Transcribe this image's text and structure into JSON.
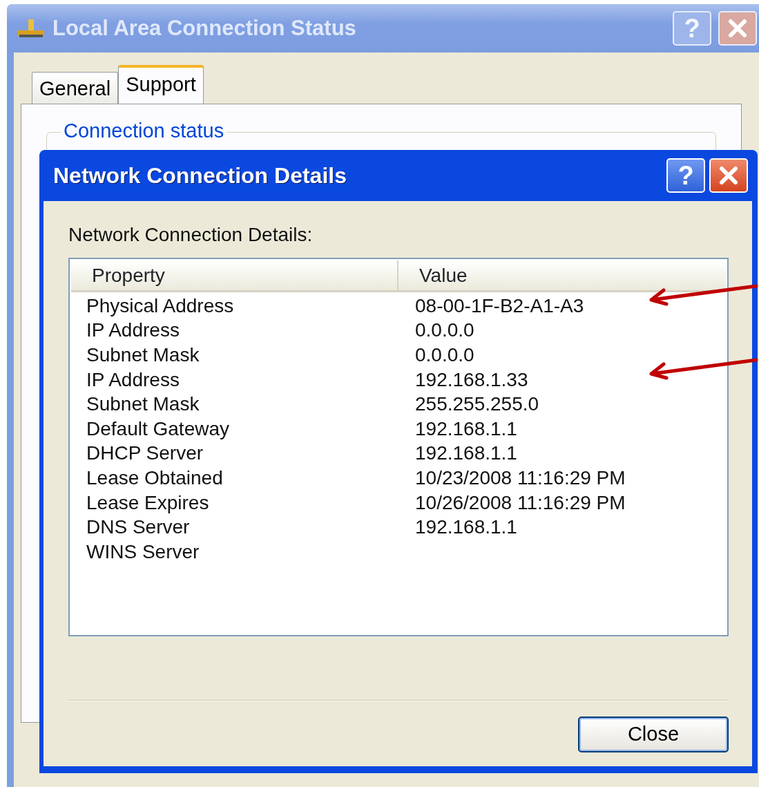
{
  "outer_window": {
    "title": "Local Area Connection Status",
    "help_button": "?",
    "tabs": [
      {
        "label": "General",
        "selected": false
      },
      {
        "label": "Support",
        "selected": true
      }
    ],
    "group_label": "Connection status"
  },
  "dialog": {
    "title": "Network Connection Details",
    "help_button": "?",
    "label": "Network Connection Details:",
    "columns": [
      "Property",
      "Value"
    ],
    "rows": [
      {
        "property": "Physical Address",
        "value": "08-00-1F-B2-A1-A3",
        "marked": true
      },
      {
        "property": "IP Address",
        "value": "0.0.0.0",
        "marked": false
      },
      {
        "property": "Subnet Mask",
        "value": "0.0.0.0",
        "marked": false
      },
      {
        "property": "IP Address",
        "value": "192.168.1.33",
        "marked": true
      },
      {
        "property": "Subnet Mask",
        "value": "255.255.255.0",
        "marked": false
      },
      {
        "property": "Default Gateway",
        "value": "192.168.1.1",
        "marked": false
      },
      {
        "property": "DHCP Server",
        "value": "192.168.1.1",
        "marked": false
      },
      {
        "property": "Lease Obtained",
        "value": "10/23/2008 11:16:29 PM",
        "marked": false
      },
      {
        "property": "Lease Expires",
        "value": "10/26/2008 11:16:29 PM",
        "marked": false
      },
      {
        "property": "DNS Server",
        "value": "192.168.1.1",
        "marked": false
      },
      {
        "property": "WINS Server",
        "marked": false
      }
    ],
    "buttons": [
      "Close"
    ]
  }
}
